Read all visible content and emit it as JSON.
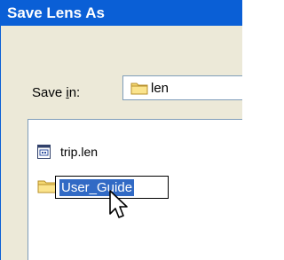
{
  "window": {
    "title": "Save Lens As"
  },
  "save_in": {
    "label_prefix": "Save ",
    "label_accel": "i",
    "label_suffix": "n:",
    "folder_icon": "folder-icon",
    "value": "len"
  },
  "files": [
    {
      "name": "trip.len",
      "icon": "lens-file-icon"
    },
    {
      "name": "User_Guide",
      "icon": "folder-icon",
      "renaming": true
    }
  ],
  "colors": {
    "titlebar": "#0a5fd6",
    "dialog_bg": "#ece9d8",
    "selection": "#316ac5"
  }
}
